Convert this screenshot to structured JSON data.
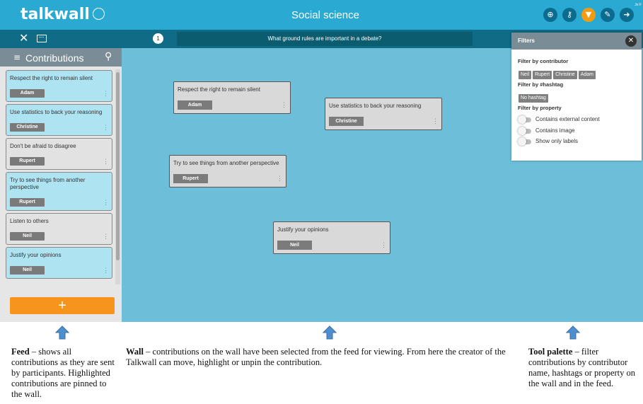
{
  "header": {
    "logo_text": "talkwall",
    "wall_title": "Social science",
    "user_tag": "Jo F",
    "tool_icons": [
      "zoom-icon",
      "key-icon",
      "filter-icon",
      "pencil-icon",
      "logout-icon"
    ],
    "colors": {
      "topbar": "#2aa9d3",
      "subbar": "#106b87",
      "accent": "#f39c12",
      "wall": "#6dbfd9"
    }
  },
  "question": {
    "number": "1",
    "text": "What ground rules are important in a debate?"
  },
  "feed": {
    "title": "Contributions",
    "add_label": "+",
    "items": [
      {
        "text": "Respect the right to remain silent",
        "author": "Adam",
        "pinned": true
      },
      {
        "text": "Use statistics to back your reasoning",
        "author": "Christine",
        "pinned": true
      },
      {
        "text": "Don't be afraid to disagree",
        "author": "Rupert",
        "pinned": false
      },
      {
        "text": "Try to see things from another perspective",
        "author": "Rupert",
        "pinned": true
      },
      {
        "text": "Listen to others",
        "author": "Neil",
        "pinned": false
      },
      {
        "text": "Justify your opinions",
        "author": "Neil",
        "pinned": true
      }
    ]
  },
  "wall": {
    "items": [
      {
        "text": "Respect the right to remain silent",
        "author": "Adam"
      },
      {
        "text": "Use statistics to back your reasoning",
        "author": "Christine"
      },
      {
        "text": "Try to see things from another perspective",
        "author": "Rupert"
      },
      {
        "text": "Justify your opinions",
        "author": "Neil"
      }
    ]
  },
  "filters": {
    "title": "Filters",
    "by_contributor_label": "Filter by contributor",
    "contributors": [
      "Neil",
      "Rupert",
      "Christine",
      "Adam"
    ],
    "by_hashtag_label": "Filter by #hashtag",
    "hashtags": [
      "No hashtag"
    ],
    "by_property_label": "Filter by property",
    "properties": [
      {
        "label": "Contains external content",
        "on": false
      },
      {
        "label": "Contains image",
        "on": false
      },
      {
        "label": "Show only labels",
        "on": false
      }
    ]
  },
  "captions": {
    "feed": {
      "title": "Feed",
      "text": " – shows all contributions as they are sent by participants. Highlighted contributions are pinned to the wall."
    },
    "wall": {
      "title": "Wall",
      "text": " – contributions on the wall have been selected from the feed for viewing. From here the creator of the Talkwall can move, highlight or unpin the contribution."
    },
    "palette": {
      "title": "Tool palette",
      "text": " – filter contributions by contributor name, hashtags or property on the wall and in the feed."
    }
  }
}
